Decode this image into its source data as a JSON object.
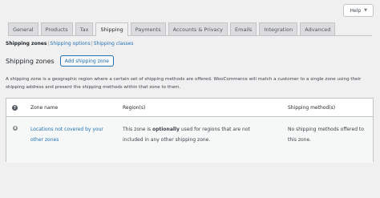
{
  "help": {
    "label": "Help"
  },
  "tabs": [
    {
      "label": "General",
      "active": false
    },
    {
      "label": "Products",
      "active": false
    },
    {
      "label": "Tax",
      "active": false
    },
    {
      "label": "Shipping",
      "active": true
    },
    {
      "label": "Payments",
      "active": false
    },
    {
      "label": "Accounts & Privacy",
      "active": false
    },
    {
      "label": "Emails",
      "active": false
    },
    {
      "label": "Integration",
      "active": false
    },
    {
      "label": "Advanced",
      "active": false
    }
  ],
  "subnav": {
    "current": "Shipping zones",
    "separator": "|",
    "options": "Shipping options",
    "classes": "Shipping classes"
  },
  "heading": {
    "title": "Shipping zones",
    "add_button": "Add shipping zone"
  },
  "description": "A shipping zone is a geographic region where a certain set of shipping methods are offered. WooCommerce will match a customer to a single zone using their shipping address and present the shipping methods within that zone to them.",
  "table": {
    "help_glyph": "?",
    "headers": {
      "zone_name": "Zone name",
      "regions": "Region(s)",
      "methods": "Shipping method(s)"
    },
    "row": {
      "zone_name": "Locations not covered by your other zones",
      "regions_prefix": "This zone is ",
      "regions_emphasis": "optionally",
      "regions_suffix": " used for regions that are not included in any other shipping zone.",
      "methods": "No shipping methods offered to this zone."
    }
  }
}
